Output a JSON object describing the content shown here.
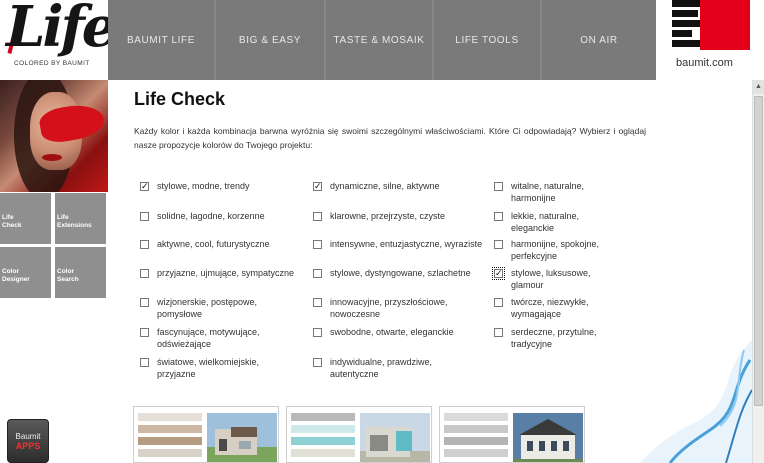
{
  "logo": {
    "text": "Life",
    "tagline": "COLORED BY BAUMIT"
  },
  "nav": [
    {
      "label": "BAUMIT LIFE"
    },
    {
      "label": "BIG & EASY"
    },
    {
      "label": "TASTE & MOSAIK"
    },
    {
      "label": "LIFE TOOLS"
    },
    {
      "label": "ON AIR"
    }
  ],
  "brand": {
    "url": "baumit.com"
  },
  "sidebar": {
    "tiles": [
      {
        "label": "Life\nCheck"
      },
      {
        "label": "Life\nExtensions"
      },
      {
        "label": "Color\nDesigner"
      },
      {
        "label": "Color\nSearch"
      }
    ],
    "apps": {
      "top": "Baumit",
      "bottom": "APPS"
    }
  },
  "main": {
    "title": "Life Check",
    "intro": "Każdy kolor i każda kombinacja barwna wyróżnia się swoimi szczególnymi właściwościami. Które Ci odpowiadają? Wybierz i oglądaj nasze propozycje kolorów do Twojego projektu:",
    "options": [
      {
        "label": "stylowe, modne, trendy",
        "checked": true
      },
      {
        "label": "dynamiczne, silne, aktywne",
        "checked": true
      },
      {
        "label": "witalne, naturalne, harmonijne",
        "checked": false
      },
      {
        "label": "solidne, łagodne, korzenne",
        "checked": false
      },
      {
        "label": "klarowne, przejrzyste, czyste",
        "checked": false
      },
      {
        "label": "lekkie, naturalne, eleganckie",
        "checked": false
      },
      {
        "label": "aktywne, cool, futurystyczne",
        "checked": false
      },
      {
        "label": "intensywne, entuzjastyczne, wyraziste",
        "checked": false
      },
      {
        "label": "harmonijne, spokojne, perfekcyjne",
        "checked": false
      },
      {
        "label": "przyjazne, ujmujące, sympatyczne",
        "checked": false
      },
      {
        "label": "stylowe, dystyngowane, szlachetne",
        "checked": false
      },
      {
        "label": "stylowe, luksusowe, glamour",
        "checked": true
      },
      {
        "label": "wizjonerskie, postępowe, pomysłowe",
        "checked": false
      },
      {
        "label": "innowacyjne, przyszłościowe, nowoczesne",
        "checked": false
      },
      {
        "label": "twórcze, niezwykłe, wymagające",
        "checked": false
      },
      {
        "label": "fascynujące, motywujące, odświeżające",
        "checked": false
      },
      {
        "label": "swobodne, otwarte, eleganckie",
        "checked": false
      },
      {
        "label": "serdeczne, przytulne, tradycyjne",
        "checked": false
      },
      {
        "label": "światowe, wielkomiejskie, przyjazne",
        "checked": false
      },
      {
        "label": "indywidualne, prawdziwe, autentyczne",
        "checked": false
      }
    ],
    "thumbs": [
      {
        "swatches": [
          "#e5dfd8",
          "#cdb8a5",
          "#b79c84",
          "#d9d2c8"
        ]
      },
      {
        "swatches": [
          "#b9b9b9",
          "#cfe8ea",
          "#8fd0d4",
          "#e0e0d6"
        ]
      },
      {
        "swatches": [
          "#dadada",
          "#c8c8c8",
          "#b4b4b4",
          "#d0d0d0"
        ]
      }
    ]
  },
  "colors": {
    "nav_bg": "#7a7a7a",
    "tile_bg": "#8f8f8f",
    "brand_red": "#e3001b"
  }
}
